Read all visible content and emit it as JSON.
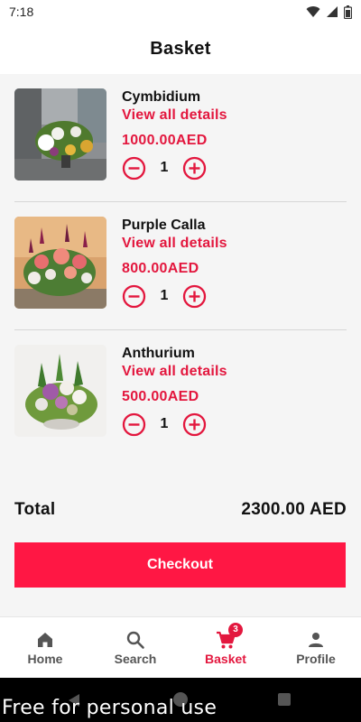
{
  "status_bar": {
    "time": "7:18",
    "icons": [
      "wifi-icon",
      "signal-icon",
      "battery-icon"
    ]
  },
  "header": {
    "title": "Basket"
  },
  "items": [
    {
      "name": "Cymbidium",
      "details_label": "View all details",
      "price": "1000.00AED",
      "quantity": "1",
      "image": "flower-arrangement-cymbidium"
    },
    {
      "name": "Purple Calla",
      "details_label": "View all details",
      "price": "800.00AED",
      "quantity": "1",
      "image": "flower-arrangement-purple-calla"
    },
    {
      "name": "Anthurium",
      "details_label": "View all details",
      "price": "500.00AED",
      "quantity": "1",
      "image": "flower-arrangement-anthurium"
    }
  ],
  "summary": {
    "total_label": "Total",
    "total_value": "2300.00 AED"
  },
  "checkout": {
    "label": "Checkout"
  },
  "bottom_nav": [
    {
      "label": "Home",
      "icon": "home-icon"
    },
    {
      "label": "Search",
      "icon": "search-icon"
    },
    {
      "label": "Basket",
      "icon": "cart-icon",
      "badge": "3",
      "active": true
    },
    {
      "label": "Profile",
      "icon": "profile-icon"
    }
  ],
  "watermark": "Free for personal use",
  "colors": {
    "accent": "#e3173e",
    "button": "#ff1744",
    "background": "#f5f5f5"
  }
}
